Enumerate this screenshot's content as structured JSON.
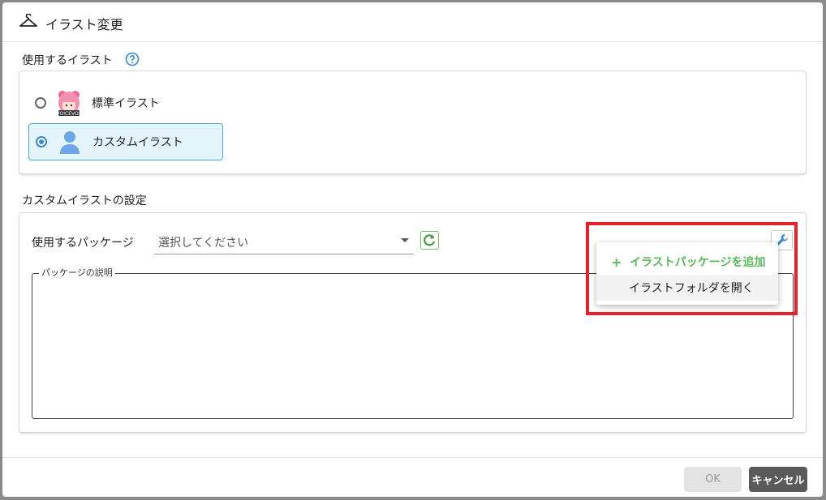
{
  "dialog": {
    "title": "イラスト変更",
    "title_icon": "hanger-icon"
  },
  "illust_section": {
    "label": "使用するイラスト",
    "help_icon": "help-circle-icon",
    "options": [
      {
        "label": "標準イラスト",
        "selected": false,
        "thumb_caption": "VOICEVOX"
      },
      {
        "label": "カスタムイラスト",
        "selected": true
      }
    ]
  },
  "custom_section": {
    "label": "カスタムイラストの設定",
    "package_label": "使用するパッケージ",
    "select_placeholder": "選択してください",
    "description_legend": "パッケージの説明",
    "description_value": ""
  },
  "menu": {
    "items": [
      {
        "label": "イラストパッケージを追加",
        "icon": "plus-icon"
      },
      {
        "label": "イラストフォルダを開く"
      }
    ]
  },
  "footer": {
    "ok_label": "OK",
    "cancel_label": "キャンセル"
  },
  "colors": {
    "accent_blue": "#3a87ce",
    "add_green": "#5cb85c",
    "highlight_red": "#e8202a",
    "selected_bg": "#e3f4fb"
  }
}
